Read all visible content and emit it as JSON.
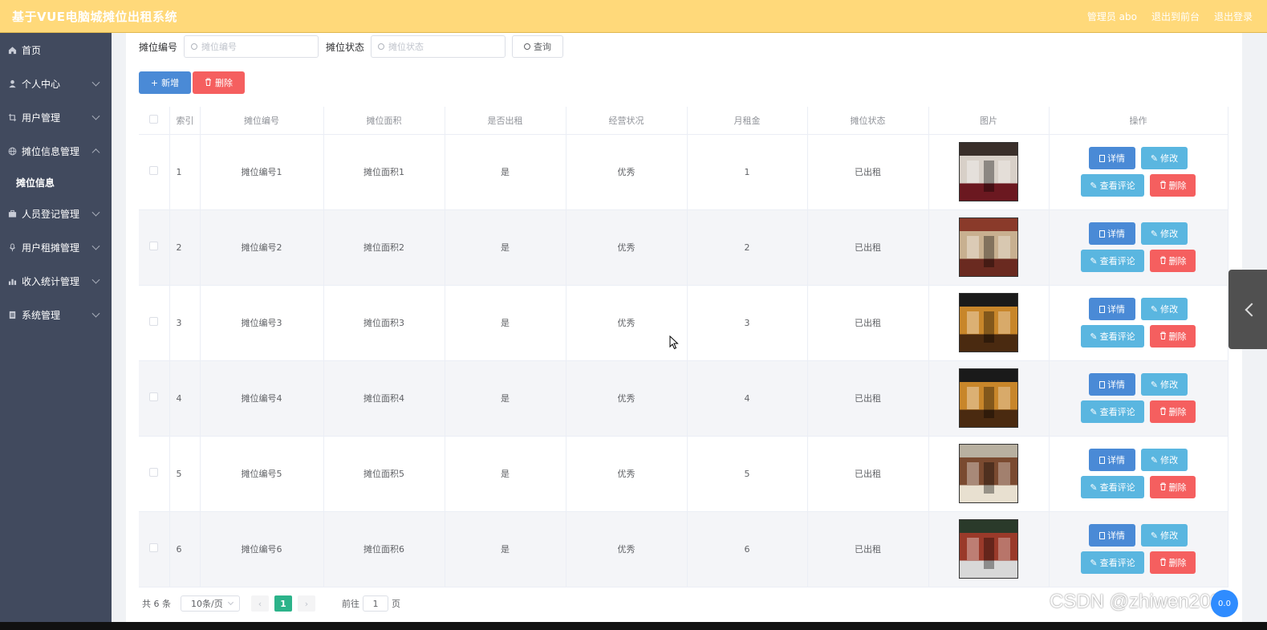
{
  "header": {
    "title": "基于VUE电脑城摊位出租系统",
    "user": "管理员 abo",
    "back_front": "退出到前台",
    "logout": "退出登录"
  },
  "sidebar": {
    "items": [
      {
        "label": "首页",
        "icon": "home-icon"
      },
      {
        "label": "个人中心",
        "icon": "user-icon"
      },
      {
        "label": "用户管理",
        "icon": "crop-icon"
      },
      {
        "label": "摊位信息管理",
        "icon": "globe-icon"
      },
      {
        "label": "摊位信息"
      },
      {
        "label": "人员登记管理",
        "icon": "briefcase-icon"
      },
      {
        "label": "用户租摊管理",
        "icon": "mic-icon"
      },
      {
        "label": "收入统计管理",
        "icon": "chart-icon"
      },
      {
        "label": "系统管理",
        "icon": "document-icon"
      }
    ]
  },
  "search": {
    "code_label": "摊位编号",
    "code_placeholder": "摊位编号",
    "status_label": "摊位状态",
    "status_placeholder": "摊位状态",
    "query_label": "查询"
  },
  "toolbar": {
    "add_label": "新增",
    "delete_label": "删除"
  },
  "table": {
    "headers": [
      "索引",
      "摊位编号",
      "摊位面积",
      "是否出租",
      "经营状况",
      "月租金",
      "摊位状态",
      "图片",
      "操作"
    ],
    "rows": [
      {
        "index": "1",
        "code": "摊位编号1",
        "area": "摊位面积1",
        "rented": "是",
        "operation": "优秀",
        "rent": "1",
        "status": "已出租"
      },
      {
        "index": "2",
        "code": "摊位编号2",
        "area": "摊位面积2",
        "rented": "是",
        "operation": "优秀",
        "rent": "2",
        "status": "已出租"
      },
      {
        "index": "3",
        "code": "摊位编号3",
        "area": "摊位面积3",
        "rented": "是",
        "operation": "优秀",
        "rent": "3",
        "status": "已出租"
      },
      {
        "index": "4",
        "code": "摊位编号4",
        "area": "摊位面积4",
        "rented": "是",
        "operation": "优秀",
        "rent": "4",
        "status": "已出租"
      },
      {
        "index": "5",
        "code": "摊位编号5",
        "area": "摊位面积5",
        "rented": "是",
        "operation": "优秀",
        "rent": "5",
        "status": "已出租"
      },
      {
        "index": "6",
        "code": "摊位编号6",
        "area": "摊位面积6",
        "rented": "是",
        "operation": "优秀",
        "rent": "6",
        "status": "已出租"
      }
    ],
    "actions": {
      "detail": "详情",
      "edit": "修改",
      "comment": "查看评论",
      "delete": "删除"
    }
  },
  "pagination": {
    "total": "共 6 条",
    "page_size": "10条/页",
    "current_page": "1",
    "goto_prefix": "前往",
    "goto_value": "1",
    "goto_suffix": "页"
  },
  "watermark": "CSDN @zhiwen203",
  "badge": "0.0",
  "colors": {
    "header": "#ffd97a",
    "sidebar": "#414a5e",
    "primary": "#4a8ad6",
    "info": "#5ab6e0",
    "danger": "#f55f5f",
    "pager_active": "#2cb38a"
  }
}
